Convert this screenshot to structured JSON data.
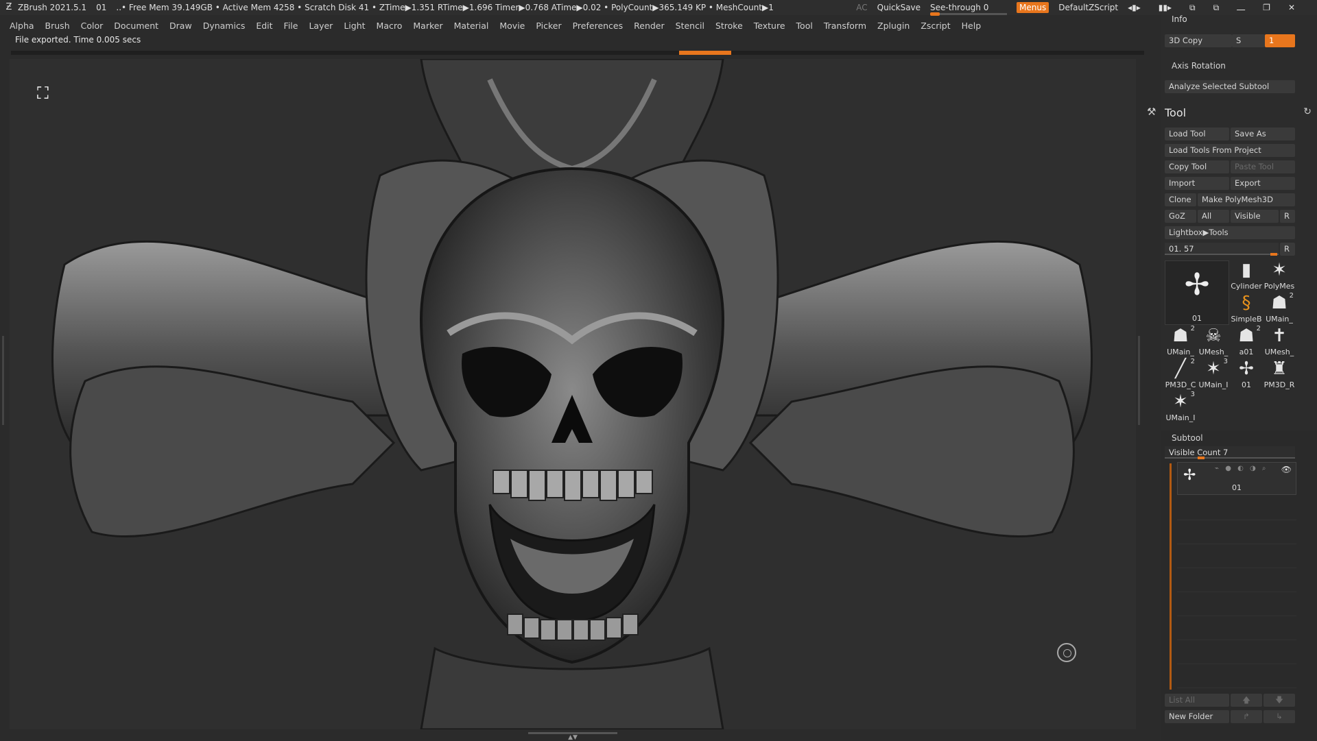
{
  "titlebar": {
    "app": "ZBrush 2021.5.1",
    "doc": "01",
    "info": "..• Free Mem 39.149GB • Active Mem 4258 • Scratch Disk 41 •  ZTime▶1.351 RTime▶1.696 Timer▶0.768 ATime▶0.02 • PolyCount▶365.149 KP  • MeshCount▶1",
    "ac": "AC",
    "quicksave": "QuickSave",
    "seethrough": "See-through  0",
    "menus": "Menus",
    "script": "DefaultZScript"
  },
  "menubar": [
    "Alpha",
    "Brush",
    "Color",
    "Document",
    "Draw",
    "Dynamics",
    "Edit",
    "File",
    "Layer",
    "Light",
    "Macro",
    "Marker",
    "Material",
    "Movie",
    "Picker",
    "Preferences",
    "Render",
    "Stencil",
    "Stroke",
    "Texture",
    "Tool",
    "Transform",
    "Zplugin",
    "Zscript",
    "Help"
  ],
  "status_text": "File exported. Time 0.005 secs",
  "rightpanel": {
    "info_label": "Info",
    "copy3d": "3D Copy",
    "s_label": "S",
    "s_value": "1",
    "axis_rotation": "Axis Rotation",
    "analyze": "Analyze Selected Subtool",
    "tool_title": "Tool",
    "load_tool": "Load Tool",
    "save_as": "Save As",
    "load_from_project": "Load Tools From Project",
    "copy_tool": "Copy Tool",
    "paste_tool": "Paste Tool",
    "import": "Import",
    "export": "Export",
    "clone": "Clone",
    "make_polymesh": "Make PolyMesh3D",
    "goz": "GoZ",
    "all": "All",
    "visible": "Visible",
    "r": "R",
    "lightbox": "Lightbox▶Tools",
    "tool_slider": "01. 57",
    "tool_slider_r": "R",
    "current_tool": "01",
    "thumbs": [
      {
        "label": "Cylinder",
        "num": "",
        "icon": "cylinder-icon"
      },
      {
        "label": "PolyMes",
        "num": "",
        "icon": "star-icon"
      },
      {
        "label": "SimpleB",
        "num": "",
        "icon": "simplebrush-icon"
      },
      {
        "label": "UMain_",
        "num": "2",
        "icon": "bust-icon"
      },
      {
        "label": "UMain_",
        "num": "2",
        "icon": "bust-icon"
      },
      {
        "label": "UMesh_",
        "num": "",
        "icon": "skull-icon"
      },
      {
        "label": "a01",
        "num": "2",
        "icon": "bust-icon"
      },
      {
        "label": "UMesh_",
        "num": "",
        "icon": "cross-icon"
      },
      {
        "label": "PM3D_C",
        "num": "2",
        "icon": "stick-icon"
      },
      {
        "label": "UMain_I",
        "num": "3",
        "icon": "star-icon"
      },
      {
        "label": "01",
        "num": "",
        "icon": "mesh-icon"
      },
      {
        "label": "PM3D_R",
        "num": "",
        "icon": "torso-icon"
      },
      {
        "label": "UMain_I",
        "num": "3",
        "icon": "star-icon"
      }
    ],
    "subtool_label": "Subtool",
    "visible_count": "Visible Count 7",
    "subtool_name": "01",
    "list_all": "List All",
    "new_folder": "New Folder"
  },
  "colors": {
    "accent": "#e8761d",
    "bg": "#2b2b2b",
    "panel": "#3a3a3a"
  }
}
